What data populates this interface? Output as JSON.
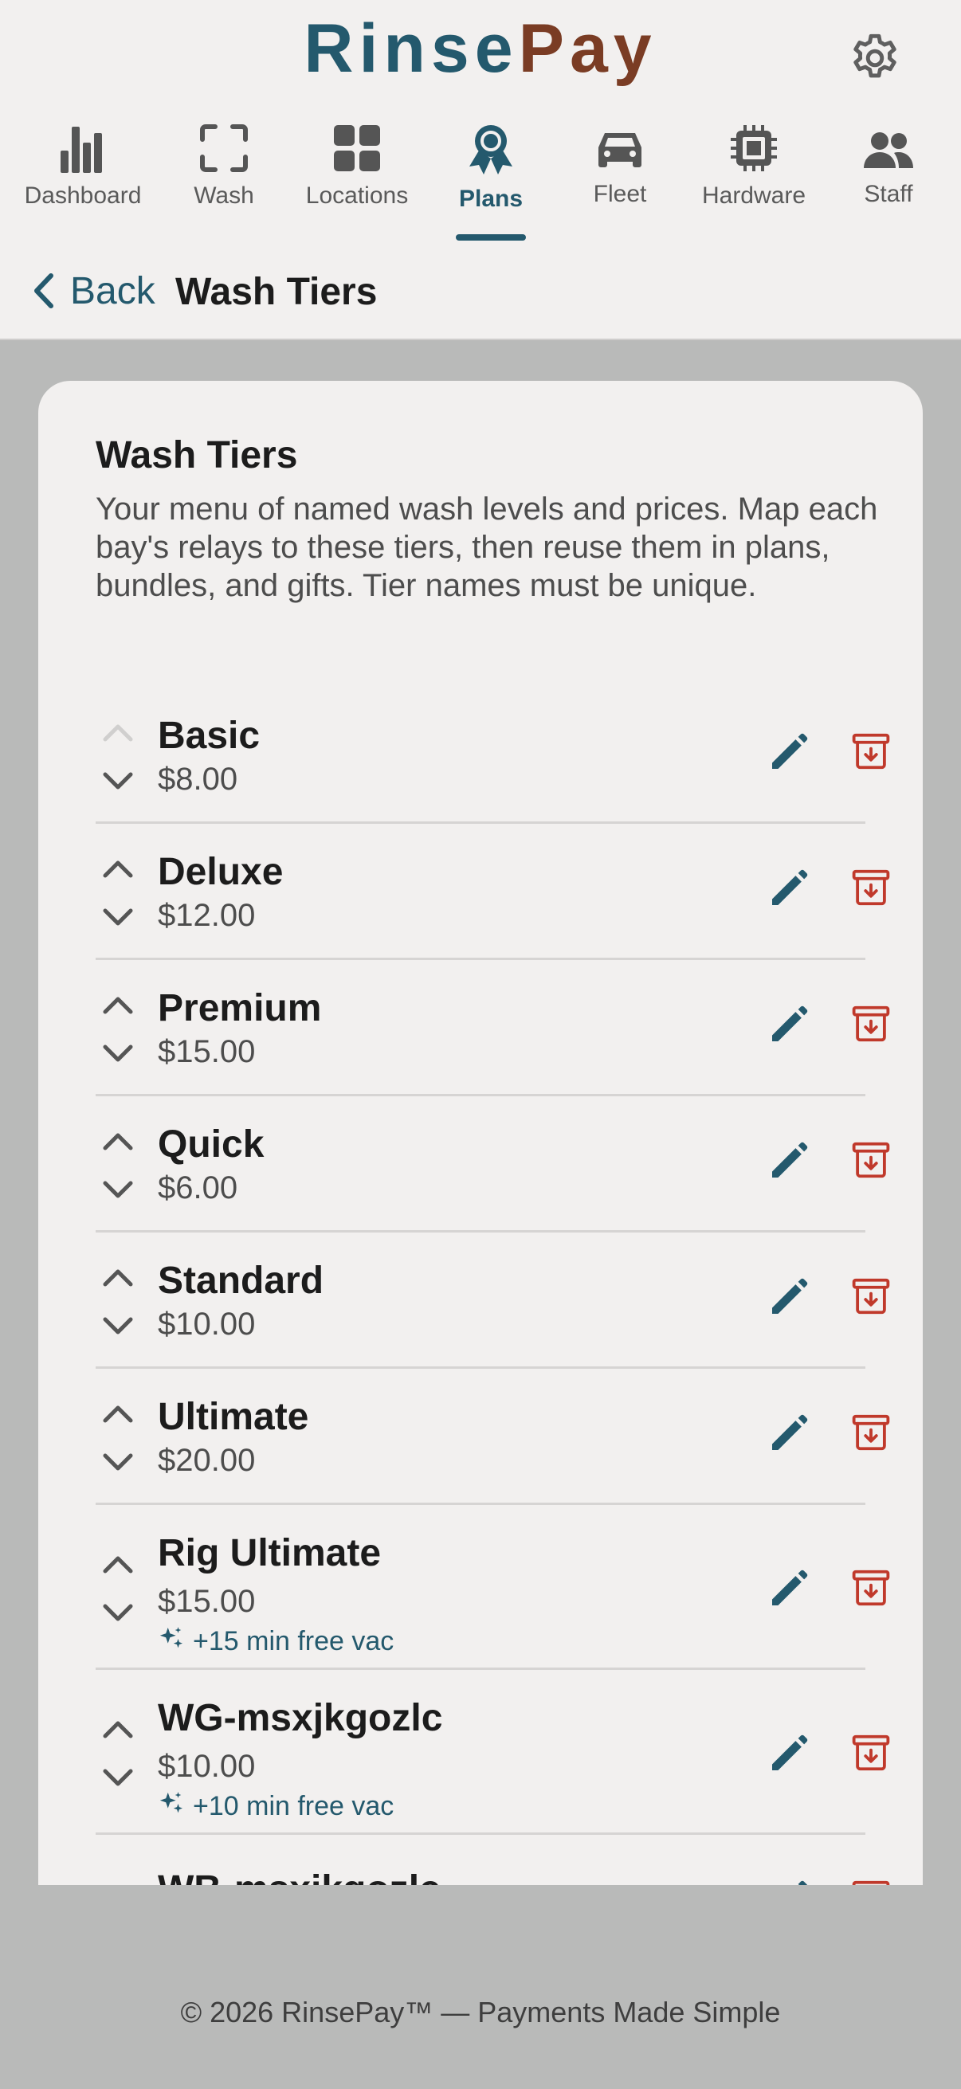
{
  "brand": {
    "part1": "Rinse",
    "part2": "Pay"
  },
  "nav": [
    {
      "label": "Dashboard",
      "icon": "bar-chart-icon"
    },
    {
      "label": "Wash",
      "icon": "scan-frame-icon"
    },
    {
      "label": "Locations",
      "icon": "grid-icon"
    },
    {
      "label": "Plans",
      "icon": "award-ribbon-icon",
      "active": true
    },
    {
      "label": "Fleet",
      "icon": "car-icon"
    },
    {
      "label": "Hardware",
      "icon": "chip-icon"
    },
    {
      "label": "Staff",
      "icon": "people-icon"
    }
  ],
  "subbar": {
    "back_label": "Back",
    "title": "Wash Tiers"
  },
  "card": {
    "title": "Wash Tiers",
    "description": "Your menu of named wash levels and prices. Map each bay's relays to these tiers, then reuse them in plans, bundles, and gifts. Tier names must be unique."
  },
  "tiers": [
    {
      "name": "Basic",
      "price": "$8.00",
      "extra": ""
    },
    {
      "name": "Deluxe",
      "price": "$12.00",
      "extra": ""
    },
    {
      "name": "Premium",
      "price": "$15.00",
      "extra": ""
    },
    {
      "name": "Quick",
      "price": "$6.00",
      "extra": ""
    },
    {
      "name": "Standard",
      "price": "$10.00",
      "extra": ""
    },
    {
      "name": "Ultimate",
      "price": "$20.00",
      "extra": ""
    },
    {
      "name": "Rig Ultimate",
      "price": "$15.00",
      "extra": "+15 min free vac"
    },
    {
      "name": "WG-msxjkgozlc",
      "price": "$10.00",
      "extra": "+10 min free vac"
    },
    {
      "name": "WB-msxjkgozlc",
      "price": "",
      "extra": ""
    }
  ],
  "footer": "© 2026 RinsePay™ — Payments Made Simple",
  "colors": {
    "primary": "#24596d",
    "accent": "#7a3c24",
    "danger": "#c0392b",
    "backdrop": "#b9bab9"
  }
}
